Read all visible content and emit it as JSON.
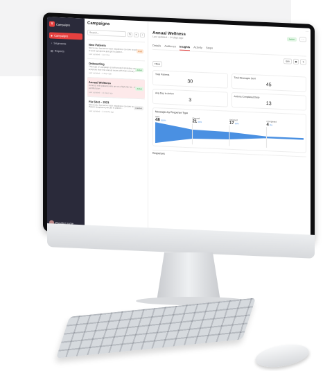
{
  "sidebar": {
    "brand": "Campaigns",
    "logo_letter": "Y",
    "items": [
      {
        "label": "Campaigns",
        "active": true
      },
      {
        "label": "Segments",
        "active": false
      },
      {
        "label": "Reports",
        "active": false
      }
    ],
    "user_name": "Provider name"
  },
  "list": {
    "title": "Campaigns",
    "search_placeholder": "Search...",
    "campaigns": [
      {
        "title": "New Patients",
        "desc": "Since your last serve track negatives. Go over to patients or poor symptoms just get to patient...",
        "updated": "Last updated – Just now",
        "status": "Draft"
      },
      {
        "title": "Onboarding",
        "desc": "This type of campaign is built around reminding users to schedule their first annual exam with their primary...",
        "updated": "Last updated – 3 days ago",
        "status": "Active"
      },
      {
        "title": "Annual Wellness",
        "desc": "Connect with patients who are at a high risk for... to a certified part",
        "updated": "Last updated – 14 days ago",
        "status": "Active"
      },
      {
        "title": "Flu Shot – 2023",
        "desc": "Since your last serve track negatives. Go over to come in. Poorer symptoms just get to patient...",
        "updated": "Last updated – 3 months ago",
        "status": "Inactive"
      }
    ]
  },
  "detail": {
    "title": "Annual Wellness",
    "subtitle": "Last updated – 14 days ago",
    "status": "Active",
    "tabs": [
      "Details",
      "Audience",
      "Insights",
      "Activity",
      "Steps"
    ],
    "active_tab": "Insights",
    "edit_label": "Edit",
    "filter_label": "Filters",
    "stats": [
      {
        "label": "Total Patients",
        "value": "30"
      },
      {
        "label": "Total Messages Sent",
        "value": "45"
      },
      {
        "label": "Avg Day to Action",
        "value": "3"
      },
      {
        "label": "Actions Completed Daily",
        "value": "13"
      }
    ],
    "chart_title": "Messages by Response Type",
    "responses_label": "Responses"
  },
  "chart_data": {
    "type": "area",
    "title": "Messages by Response Type",
    "categories": [
      "Sent",
      "Opened",
      "Actioned",
      "Completed"
    ],
    "values": [
      48,
      21,
      17,
      4
    ],
    "percents": [
      "100%",
      "44%",
      "35%",
      "8%"
    ]
  },
  "colors": {
    "accent": "#e5403f",
    "sidebar": "#2a2a3a",
    "chart": "#4a90e2"
  }
}
